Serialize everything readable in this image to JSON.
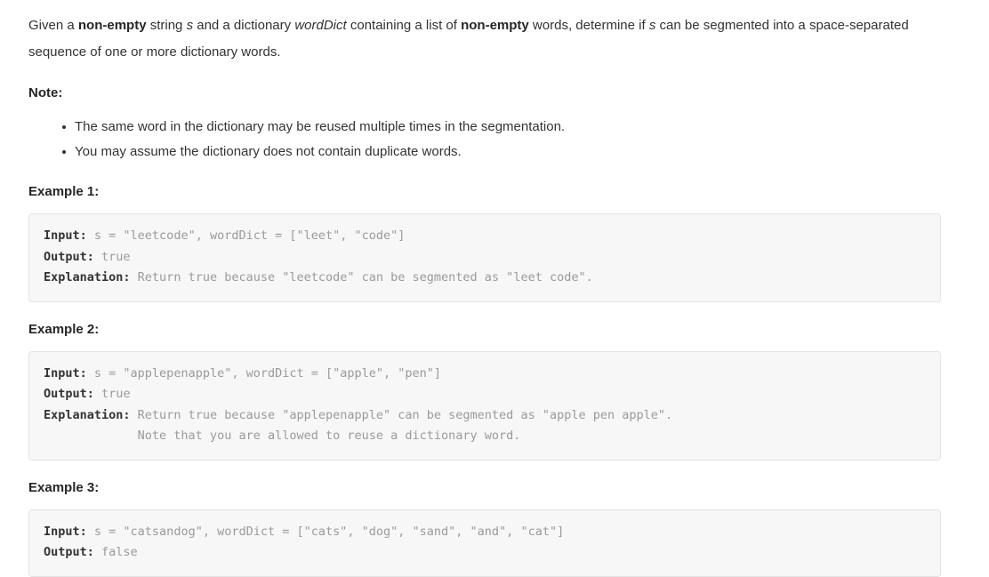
{
  "problem": {
    "statement_parts": [
      {
        "text": "Given a ",
        "style": "normal"
      },
      {
        "text": "non-empty",
        "style": "bold"
      },
      {
        "text": " string ",
        "style": "normal"
      },
      {
        "text": "s",
        "style": "italic"
      },
      {
        "text": " and a dictionary ",
        "style": "normal"
      },
      {
        "text": "wordDict",
        "style": "italic"
      },
      {
        "text": " containing a list of ",
        "style": "normal"
      },
      {
        "text": "non-empty",
        "style": "bold"
      },
      {
        "text": " words, determine if ",
        "style": "normal"
      },
      {
        "text": "s",
        "style": "italic"
      },
      {
        "text": " can be segmented into a space-separated sequence of one or more dictionary words.",
        "style": "normal"
      }
    ],
    "intro_segment_1": "Given a ",
    "intro_bold_1": "non-empty",
    "intro_segment_2": " string ",
    "intro_italic_1": "s",
    "intro_segment_3": " and a dictionary ",
    "intro_italic_2": "wordDict",
    "intro_segment_4": " containing a list of ",
    "intro_bold_2": "non-empty",
    "intro_segment_5": " words, determine if ",
    "intro_italic_3": "s",
    "intro_segment_6": " can be segmented into a space-separated sequence of one or more dictionary words."
  },
  "note": {
    "heading": "Note:",
    "items": [
      "The same word in the dictionary may be reused multiple times in the segmentation.",
      "You may assume the dictionary does not contain duplicate words."
    ]
  },
  "examples": [
    {
      "heading": "Example 1:",
      "input_label": "Input:",
      "input_value": " s = \"leetcode\", wordDict = [\"leet\", \"code\"]",
      "output_label": "Output:",
      "output_value": " true",
      "explanation_label": "Explanation:",
      "explanation_value": " Return true because \"leetcode\" can be segmented as \"leet code\".",
      "explanation_continuation": ""
    },
    {
      "heading": "Example 2:",
      "input_label": "Input:",
      "input_value": " s = \"applepenapple\", wordDict = [\"apple\", \"pen\"]",
      "output_label": "Output:",
      "output_value": " true",
      "explanation_label": "Explanation:",
      "explanation_value": " Return true because \"applepenapple\" can be segmented as \"apple pen apple\".",
      "explanation_continuation": "             Note that you are allowed to reuse a dictionary word."
    },
    {
      "heading": "Example 3:",
      "input_label": "Input:",
      "input_value": " s = \"catsandog\", wordDict = [\"cats\", \"dog\", \"sand\", \"and\", \"cat\"]",
      "output_label": "Output:",
      "output_value": " false",
      "explanation_label": "",
      "explanation_value": "",
      "explanation_continuation": ""
    }
  ],
  "colors": {
    "page_background": "#ffffff",
    "body_text": "#333333",
    "heading_text": "#262626",
    "code_background": "#f7f7f7",
    "code_border": "#e3e3e3",
    "code_value_text": "#9a9a9a",
    "code_label_text": "#333333"
  }
}
